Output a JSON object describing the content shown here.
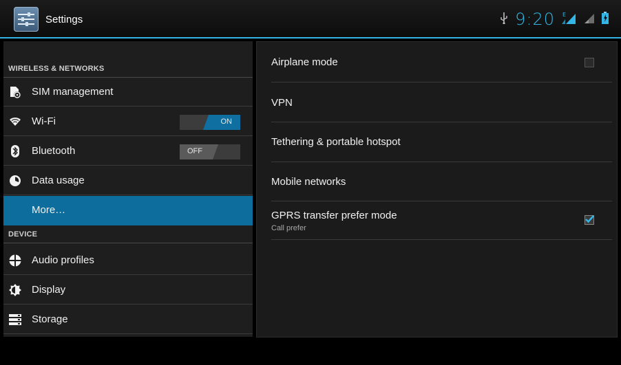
{
  "action_bar": {
    "title": "Settings",
    "clock": "9:20",
    "accent": "#33b5e5"
  },
  "sidebar": {
    "sections": [
      {
        "header": "WIRELESS & NETWORKS",
        "items": [
          {
            "label": "SIM management",
            "icon": "sim-card-icon"
          },
          {
            "label": "Wi-Fi",
            "icon": "wifi-icon",
            "toggle": "ON"
          },
          {
            "label": "Bluetooth",
            "icon": "bluetooth-icon",
            "toggle": "OFF"
          },
          {
            "label": "Data usage",
            "icon": "data-usage-icon"
          },
          {
            "label": "More…",
            "icon": "",
            "selected": true
          }
        ]
      },
      {
        "header": "DEVICE",
        "items": [
          {
            "label": "Audio profiles",
            "icon": "audio-profiles-icon"
          },
          {
            "label": "Display",
            "icon": "display-icon"
          },
          {
            "label": "Storage",
            "icon": "storage-icon"
          }
        ]
      }
    ]
  },
  "detail": {
    "items": [
      {
        "title": "Airplane mode",
        "checkbox": false
      },
      {
        "title": "VPN"
      },
      {
        "title": "Tethering & portable hotspot"
      },
      {
        "title": "Mobile networks"
      },
      {
        "title": "GPRS transfer prefer mode",
        "summary": "Call prefer",
        "checkbox": true
      }
    ]
  }
}
